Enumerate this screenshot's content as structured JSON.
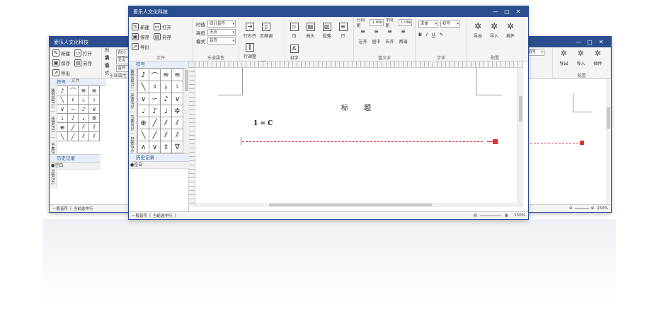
{
  "app": {
    "title": "爱乐人文化科技",
    "window_controls": [
      "—",
      "□",
      "✕"
    ]
  },
  "ribbon": {
    "file": {
      "label": "文件",
      "buttons": [
        {
          "label": "新建",
          "icon": "new-file-icon",
          "glyph": "✎"
        },
        {
          "label": "打开",
          "icon": "open-folder-icon",
          "glyph": "▭"
        },
        {
          "label": "保存",
          "icon": "save-icon",
          "glyph": "▣"
        },
        {
          "label": "另存",
          "icon": "save-as-icon",
          "glyph": "▤"
        },
        {
          "label": "导出",
          "icon": "export-icon",
          "glyph": "⇗"
        }
      ]
    },
    "score_props": {
      "label": "乐谱属性",
      "rows": [
        {
          "label": "时值",
          "value": "四分音符"
        },
        {
          "label": "高低",
          "value": "无点"
        },
        {
          "label": "模式",
          "value": "音符"
        }
      ]
    },
    "adjust": {
      "label": "调整",
      "buttons": [
        {
          "label": "行右齐",
          "icon": "align-right-icon",
          "glyph": "⇥"
        },
        {
          "label": "页缩调",
          "icon": "page-fit-icon",
          "glyph": "▯"
        },
        {
          "label": "行调整",
          "icon": "line-adjust-icon",
          "glyph": "┃"
        }
      ]
    },
    "insert": {
      "label": "插入",
      "buttons": [
        {
          "label": "页",
          "icon": "page-icon",
          "glyph": "▫"
        },
        {
          "label": "曲头",
          "icon": "header-icon",
          "glyph": "▤"
        },
        {
          "label": "段落",
          "icon": "paragraph-icon",
          "glyph": "▥"
        },
        {
          "label": "行",
          "icon": "line-icon",
          "glyph": "≡"
        },
        {
          "label": "对字",
          "icon": "lyric-icon",
          "glyph": "A"
        }
      ]
    },
    "rich_text": {
      "label": "富文本",
      "spacing": [
        {
          "label": "行间距",
          "value": "1.00"
        },
        {
          "label": "字间距",
          "value": "1.00"
        }
      ],
      "align": [
        {
          "label": "左齐",
          "icon": "align-left-icon",
          "glyph": "≡"
        },
        {
          "label": "居中",
          "icon": "align-center-icon",
          "glyph": "≡"
        },
        {
          "label": "右齐",
          "icon": "align-right-text-icon",
          "glyph": "≡"
        },
        {
          "label": "两端",
          "icon": "justify-icon",
          "glyph": "≡"
        }
      ]
    },
    "font": {
      "label": "字体",
      "family": "宋体",
      "size": "初号",
      "styles": [
        "B",
        "I",
        "U",
        "✎"
      ]
    },
    "config": {
      "label": "配置",
      "buttons": [
        {
          "label": "导出",
          "icon": "gear-export-icon",
          "glyph": "✲"
        },
        {
          "label": "导入",
          "icon": "gear-import-icon",
          "glyph": "✲"
        },
        {
          "label": "插件",
          "icon": "gear-plugin-icon",
          "glyph": "✲"
        }
      ]
    }
  },
  "sidebar": {
    "header": "符号",
    "tabs": [
      "装饰音(F1)",
      "连音(F2)",
      "节奏(F3)",
      "其他(F4)"
    ],
    "symbols": [
      "♪",
      "⌒",
      "≋",
      "≋",
      "╲",
      "♯",
      "♭",
      "♮",
      "∨",
      "∽",
      "♪",
      "∨",
      "♩",
      "♪",
      "♩",
      "✲",
      "⊕",
      "╱",
      "⫽",
      "⫽",
      "╲",
      "╱",
      "⫽",
      "⫽",
      "∧",
      "∨",
      "‡",
      "∇"
    ],
    "history_label": "历史记录",
    "history_item": "●空白"
  },
  "document": {
    "title": "标       题",
    "key": "1 = C"
  },
  "status": {
    "left": [
      "一般音符",
      "当前选中行"
    ],
    "zoom": "150%",
    "zoom_out": "⊖",
    "zoom_in": "⊕"
  },
  "colors": {
    "titlebar": "#2b4e8f",
    "staff_line": "#e03030",
    "cursor": "#3a6fc8"
  }
}
